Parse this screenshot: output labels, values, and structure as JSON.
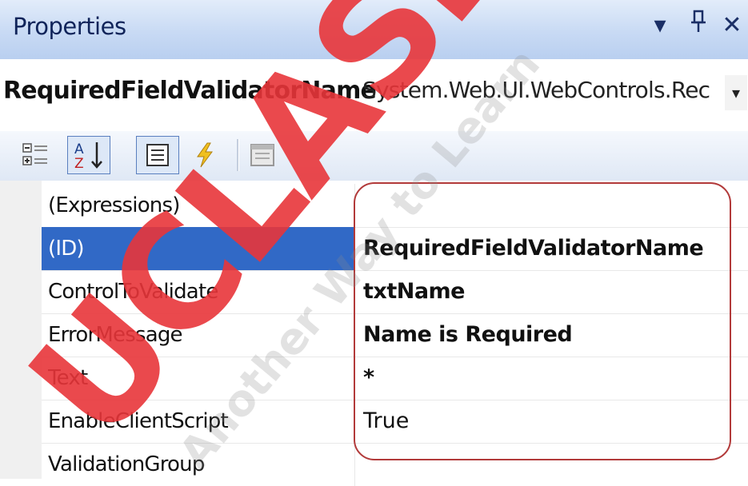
{
  "panel": {
    "title": "Properties",
    "dropdown_glyph": "▾",
    "pin_glyph": "ꟷ",
    "close_glyph": "✕"
  },
  "object_selector": {
    "name": "RequiredFieldValidatorName",
    "type": "System.Web.UI.WebControls.Rec",
    "arrow": "▾"
  },
  "toolbar": {
    "tools": [
      {
        "name": "categorized-icon",
        "pressed": false
      },
      {
        "name": "alphabetical-icon",
        "pressed": true
      },
      {
        "name": "properties-icon",
        "pressed": true
      },
      {
        "name": "events-icon",
        "pressed": false
      },
      {
        "name": "property-pages-icon",
        "pressed": false
      }
    ]
  },
  "properties": [
    {
      "name": "(Expressions)",
      "value": "",
      "bold": false,
      "selected": false
    },
    {
      "name": "(ID)",
      "value": "RequiredFieldValidatorName",
      "bold": true,
      "selected": true
    },
    {
      "name": "ControlToValidate",
      "value": "txtName",
      "bold": true,
      "selected": false
    },
    {
      "name": "ErrorMessage",
      "value": "Name is Required",
      "bold": true,
      "selected": false
    },
    {
      "name": "Text",
      "value": "*",
      "bold": true,
      "selected": false
    },
    {
      "name": "EnableClientScript",
      "value": "True",
      "bold": false,
      "selected": false
    },
    {
      "name": "ValidationGroup",
      "value": "",
      "bold": false,
      "selected": false
    }
  ],
  "watermark": {
    "brand": "UCLASH",
    "tagline": "Another Way to Learn"
  },
  "colors": {
    "selection": "#3169c6",
    "highlight_border": "#b23a3a",
    "watermark_red": "#e8353a"
  }
}
